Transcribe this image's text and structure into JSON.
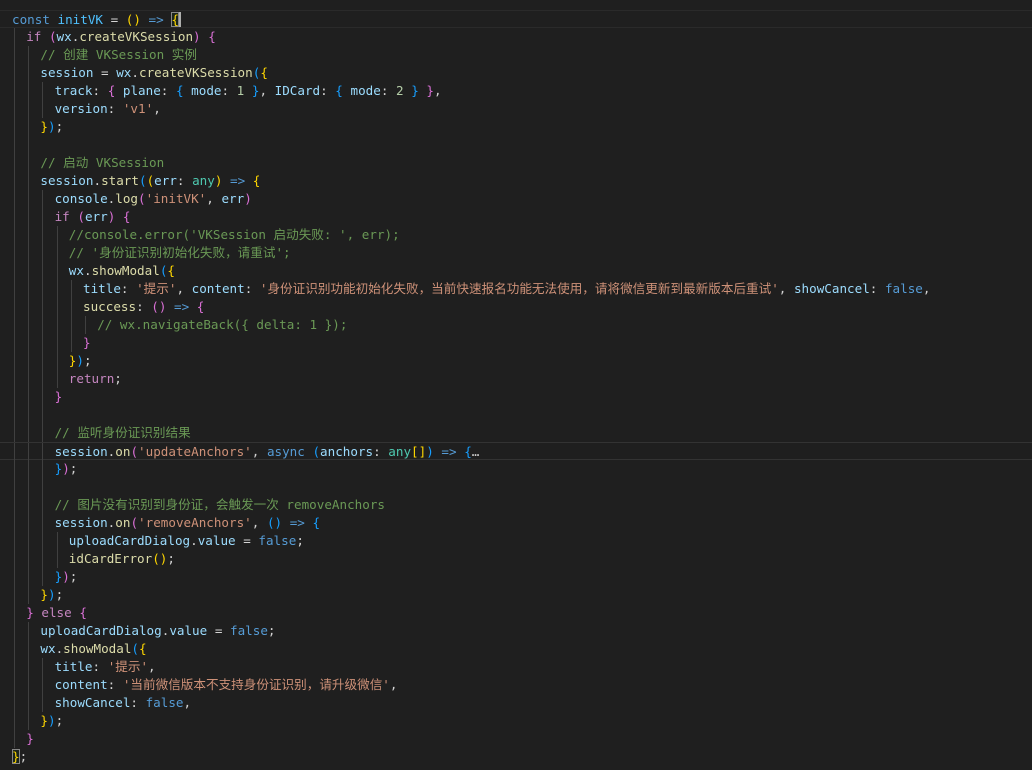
{
  "editor": {
    "theme_colors": {
      "background": "#1f1f1f",
      "keyword": "#569cd6",
      "control": "#c586c0",
      "variable": "#9cdcfe",
      "function": "#dcdcaa",
      "string": "#ce9178",
      "number": "#b5cea8",
      "comment": "#6a9955",
      "bracket_level_1": "#ffd700",
      "bracket_level_2": "#da70d6",
      "bracket_level_3": "#179fff"
    },
    "lines": [
      {
        "indent": 0,
        "tokens": [
          [
            "kw",
            "const"
          ],
          [
            "op",
            " "
          ],
          [
            "const",
            "initVK"
          ],
          [
            "op",
            " = "
          ],
          [
            "p1",
            "("
          ],
          [
            "p1",
            ")"
          ],
          [
            "op",
            " "
          ],
          [
            "kw",
            "=>"
          ],
          [
            "op",
            " "
          ],
          [
            "p1",
            "{",
            "bm"
          ],
          [
            "cursor",
            ""
          ]
        ]
      },
      {
        "indent": 1,
        "tokens": [
          [
            "ctl",
            "if"
          ],
          [
            "op",
            " "
          ],
          [
            "p2",
            "("
          ],
          [
            "var",
            "wx"
          ],
          [
            "op",
            "."
          ],
          [
            "fn",
            "createVKSession"
          ],
          [
            "p2",
            ")"
          ],
          [
            "op",
            " "
          ],
          [
            "p2",
            "{"
          ]
        ]
      },
      {
        "indent": 2,
        "tokens": [
          [
            "com",
            "// 创建 VKSession 实例"
          ]
        ]
      },
      {
        "indent": 2,
        "tokens": [
          [
            "var",
            "session"
          ],
          [
            "op",
            " = "
          ],
          [
            "var",
            "wx"
          ],
          [
            "op",
            "."
          ],
          [
            "fn",
            "createVKSession"
          ],
          [
            "p3",
            "("
          ],
          [
            "p1",
            "{"
          ]
        ]
      },
      {
        "indent": 3,
        "tokens": [
          [
            "var",
            "track"
          ],
          [
            "op",
            ": "
          ],
          [
            "p2",
            "{"
          ],
          [
            "op",
            " "
          ],
          [
            "var",
            "plane"
          ],
          [
            "op",
            ": "
          ],
          [
            "p3",
            "{"
          ],
          [
            "op",
            " "
          ],
          [
            "var",
            "mode"
          ],
          [
            "op",
            ": "
          ],
          [
            "num",
            "1"
          ],
          [
            "op",
            " "
          ],
          [
            "p3",
            "}"
          ],
          [
            "op",
            ", "
          ],
          [
            "var",
            "IDCard"
          ],
          [
            "op",
            ": "
          ],
          [
            "p3",
            "{"
          ],
          [
            "op",
            " "
          ],
          [
            "var",
            "mode"
          ],
          [
            "op",
            ": "
          ],
          [
            "num",
            "2"
          ],
          [
            "op",
            " "
          ],
          [
            "p3",
            "}"
          ],
          [
            "op",
            " "
          ],
          [
            "p2",
            "}"
          ],
          [
            "op",
            ","
          ]
        ]
      },
      {
        "indent": 3,
        "tokens": [
          [
            "var",
            "version"
          ],
          [
            "op",
            ": "
          ],
          [
            "str",
            "'v1'"
          ],
          [
            "op",
            ","
          ]
        ]
      },
      {
        "indent": 2,
        "tokens": [
          [
            "p1",
            "}"
          ],
          [
            "p3",
            ")"
          ],
          [
            "op",
            ";"
          ]
        ]
      },
      {
        "indent": 2,
        "tokens": []
      },
      {
        "indent": 2,
        "tokens": [
          [
            "com",
            "// 启动 VKSession"
          ]
        ]
      },
      {
        "indent": 2,
        "tokens": [
          [
            "var",
            "session"
          ],
          [
            "op",
            "."
          ],
          [
            "fn",
            "start"
          ],
          [
            "p3",
            "("
          ],
          [
            "p1",
            "("
          ],
          [
            "var",
            "err"
          ],
          [
            "op",
            ": "
          ],
          [
            "type",
            "any"
          ],
          [
            "p1",
            ")"
          ],
          [
            "op",
            " "
          ],
          [
            "kw",
            "=>"
          ],
          [
            "op",
            " "
          ],
          [
            "p1",
            "{"
          ]
        ]
      },
      {
        "indent": 3,
        "tokens": [
          [
            "var",
            "console"
          ],
          [
            "op",
            "."
          ],
          [
            "fn",
            "log"
          ],
          [
            "p2",
            "("
          ],
          [
            "str",
            "'initVK'"
          ],
          [
            "op",
            ", "
          ],
          [
            "var",
            "err"
          ],
          [
            "p2",
            ")"
          ]
        ]
      },
      {
        "indent": 3,
        "tokens": [
          [
            "ctl",
            "if"
          ],
          [
            "op",
            " "
          ],
          [
            "p2",
            "("
          ],
          [
            "var",
            "err"
          ],
          [
            "p2",
            ")"
          ],
          [
            "op",
            " "
          ],
          [
            "p2",
            "{"
          ]
        ]
      },
      {
        "indent": 4,
        "tokens": [
          [
            "com",
            "//console.error('VKSession 启动失败: ', err);"
          ]
        ]
      },
      {
        "indent": 4,
        "tokens": [
          [
            "com",
            "// '身份证识别初始化失败，请重试';"
          ]
        ]
      },
      {
        "indent": 4,
        "tokens": [
          [
            "var",
            "wx"
          ],
          [
            "op",
            "."
          ],
          [
            "fn",
            "showModal"
          ],
          [
            "p3",
            "("
          ],
          [
            "p1",
            "{"
          ]
        ]
      },
      {
        "indent": 5,
        "tokens": [
          [
            "var",
            "title"
          ],
          [
            "op",
            ": "
          ],
          [
            "str",
            "'提示'"
          ],
          [
            "op",
            ", "
          ],
          [
            "var",
            "content"
          ],
          [
            "op",
            ": "
          ],
          [
            "str",
            "'身份证识别功能初始化失败，当前快速报名功能无法使用，请将微信更新到最新版本后重试'"
          ],
          [
            "op",
            ", "
          ],
          [
            "var",
            "showCancel"
          ],
          [
            "op",
            ": "
          ],
          [
            "kw",
            "false"
          ],
          [
            "op",
            ","
          ]
        ]
      },
      {
        "indent": 5,
        "tokens": [
          [
            "fn",
            "success"
          ],
          [
            "op",
            ": "
          ],
          [
            "p2",
            "("
          ],
          [
            "p2",
            ")"
          ],
          [
            "op",
            " "
          ],
          [
            "kw",
            "=>"
          ],
          [
            "op",
            " "
          ],
          [
            "p2",
            "{"
          ]
        ]
      },
      {
        "indent": 6,
        "tokens": [
          [
            "com",
            "// wx.navigateBack({ delta: 1 });"
          ]
        ]
      },
      {
        "indent": 5,
        "tokens": [
          [
            "p2",
            "}"
          ]
        ]
      },
      {
        "indent": 4,
        "tokens": [
          [
            "p1",
            "}"
          ],
          [
            "p3",
            ")"
          ],
          [
            "op",
            ";"
          ]
        ]
      },
      {
        "indent": 4,
        "tokens": [
          [
            "ctl",
            "return"
          ],
          [
            "op",
            ";"
          ]
        ]
      },
      {
        "indent": 3,
        "tokens": [
          [
            "p2",
            "}"
          ]
        ]
      },
      {
        "indent": 3,
        "tokens": []
      },
      {
        "indent": 3,
        "tokens": [
          [
            "com",
            "// 监听身份证识别结果"
          ]
        ]
      },
      {
        "indent": 3,
        "current": true,
        "tokens": [
          [
            "var",
            "session"
          ],
          [
            "op",
            "."
          ],
          [
            "fn",
            "on"
          ],
          [
            "p2",
            "("
          ],
          [
            "str",
            "'updateAnchors'"
          ],
          [
            "op",
            ", "
          ],
          [
            "kw",
            "async"
          ],
          [
            "op",
            " "
          ],
          [
            "p3",
            "("
          ],
          [
            "var",
            "anchors"
          ],
          [
            "op",
            ": "
          ],
          [
            "type",
            "any"
          ],
          [
            "p1",
            "["
          ],
          [
            "p1",
            "]"
          ],
          [
            "p3",
            ")"
          ],
          [
            "op",
            " "
          ],
          [
            "kw",
            "=>"
          ],
          [
            "op",
            " "
          ],
          [
            "p3",
            "{"
          ],
          [
            "fold",
            "…"
          ]
        ]
      },
      {
        "indent": 3,
        "tokens": [
          [
            "p3",
            "}"
          ],
          [
            "p2",
            ")"
          ],
          [
            "op",
            ";"
          ]
        ]
      },
      {
        "indent": 3,
        "tokens": []
      },
      {
        "indent": 3,
        "tokens": [
          [
            "com",
            "// 图片没有识别到身份证，会触发一次 removeAnchors"
          ]
        ]
      },
      {
        "indent": 3,
        "tokens": [
          [
            "var",
            "session"
          ],
          [
            "op",
            "."
          ],
          [
            "fn",
            "on"
          ],
          [
            "p2",
            "("
          ],
          [
            "str",
            "'removeAnchors'"
          ],
          [
            "op",
            ", "
          ],
          [
            "p3",
            "("
          ],
          [
            "p3",
            ")"
          ],
          [
            "op",
            " "
          ],
          [
            "kw",
            "=>"
          ],
          [
            "op",
            " "
          ],
          [
            "p3",
            "{"
          ]
        ]
      },
      {
        "indent": 4,
        "tokens": [
          [
            "var",
            "uploadCardDialog"
          ],
          [
            "op",
            "."
          ],
          [
            "var",
            "value"
          ],
          [
            "op",
            " = "
          ],
          [
            "kw",
            "false"
          ],
          [
            "op",
            ";"
          ]
        ]
      },
      {
        "indent": 4,
        "tokens": [
          [
            "fn",
            "idCardError"
          ],
          [
            "p1",
            "("
          ],
          [
            "p1",
            ")"
          ],
          [
            "op",
            ";"
          ]
        ]
      },
      {
        "indent": 3,
        "tokens": [
          [
            "p3",
            "}"
          ],
          [
            "p2",
            ")"
          ],
          [
            "op",
            ";"
          ]
        ]
      },
      {
        "indent": 2,
        "tokens": [
          [
            "p1",
            "}"
          ],
          [
            "p3",
            ")"
          ],
          [
            "op",
            ";"
          ]
        ]
      },
      {
        "indent": 1,
        "tokens": [
          [
            "p2",
            "}"
          ],
          [
            "op",
            " "
          ],
          [
            "ctl",
            "else"
          ],
          [
            "op",
            " "
          ],
          [
            "p2",
            "{"
          ]
        ]
      },
      {
        "indent": 2,
        "tokens": [
          [
            "var",
            "uploadCardDialog"
          ],
          [
            "op",
            "."
          ],
          [
            "var",
            "value"
          ],
          [
            "op",
            " = "
          ],
          [
            "kw",
            "false"
          ],
          [
            "op",
            ";"
          ]
        ]
      },
      {
        "indent": 2,
        "tokens": [
          [
            "var",
            "wx"
          ],
          [
            "op",
            "."
          ],
          [
            "fn",
            "showModal"
          ],
          [
            "p3",
            "("
          ],
          [
            "p1",
            "{"
          ]
        ]
      },
      {
        "indent": 3,
        "tokens": [
          [
            "var",
            "title"
          ],
          [
            "op",
            ": "
          ],
          [
            "str",
            "'提示'"
          ],
          [
            "op",
            ","
          ]
        ]
      },
      {
        "indent": 3,
        "tokens": [
          [
            "var",
            "content"
          ],
          [
            "op",
            ": "
          ],
          [
            "str",
            "'当前微信版本不支持身份证识别，请升级微信'"
          ],
          [
            "op",
            ","
          ]
        ]
      },
      {
        "indent": 3,
        "tokens": [
          [
            "var",
            "showCancel"
          ],
          [
            "op",
            ": "
          ],
          [
            "kw",
            "false"
          ],
          [
            "op",
            ","
          ]
        ]
      },
      {
        "indent": 2,
        "tokens": [
          [
            "p1",
            "}"
          ],
          [
            "p3",
            ")"
          ],
          [
            "op",
            ";"
          ]
        ]
      },
      {
        "indent": 1,
        "tokens": [
          [
            "p2",
            "}"
          ]
        ]
      },
      {
        "indent": 0,
        "tokens": [
          [
            "p1",
            "}",
            "bm"
          ],
          [
            "op",
            ";"
          ]
        ]
      }
    ]
  }
}
